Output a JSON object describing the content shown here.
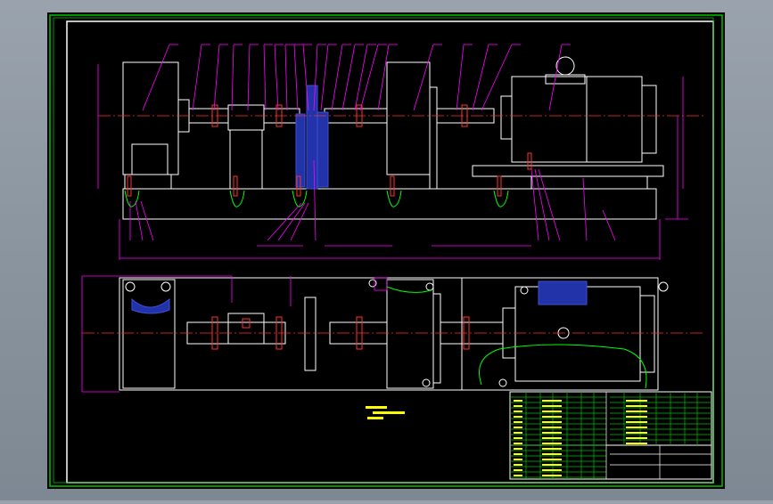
{
  "colors": {
    "frame_bg": "#000000",
    "border": "#ffffff",
    "green_border": "#00c000",
    "magenta": "#ff00ff",
    "blue": "#3a4fd6",
    "yellow": "#ffff00",
    "green": "#00ff00",
    "red": "#ff3030",
    "cyan": "#00ffff"
  },
  "icons": {
    "motor": "motor-icon",
    "gearbox": "gearbox-icon",
    "coupling": "coupling-icon",
    "bolt": "anchor-bolt-icon",
    "flywheel": "flywheel-icon"
  },
  "title_block": {
    "visible": true
  }
}
